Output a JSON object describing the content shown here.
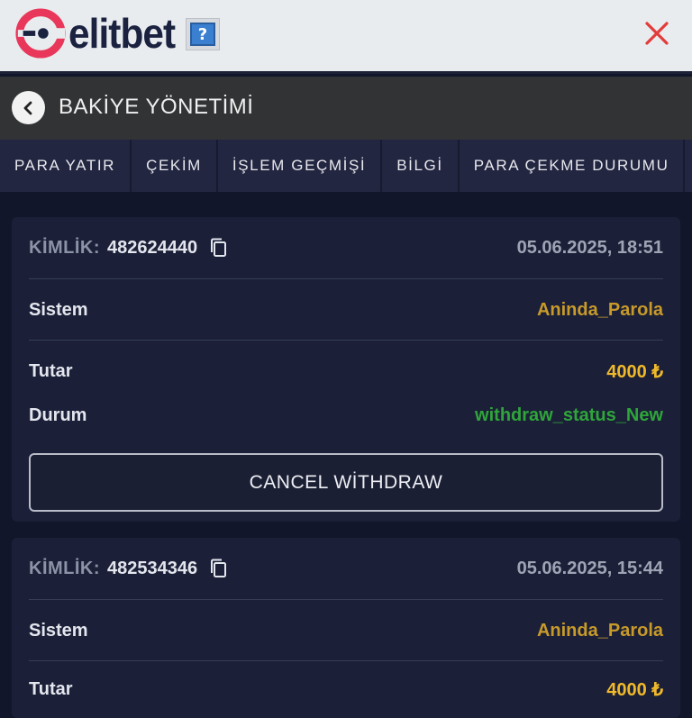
{
  "header": {
    "brand_name": "elitbet",
    "help_symbol": "?",
    "close_icon": "close-icon",
    "accent_color": "#e8375a"
  },
  "titlebar": {
    "title": "BAKİYE YÖNETİMİ",
    "back_icon": "chevron-left-icon"
  },
  "tabs": [
    {
      "label": "PARA YATIR"
    },
    {
      "label": "ÇEKİM"
    },
    {
      "label": "İŞLEM GEÇMİŞİ"
    },
    {
      "label": "BİLGİ"
    },
    {
      "label": "PARA ÇEKME DURUMU"
    }
  ],
  "withdrawals": [
    {
      "id_label": "KİMLİK:",
      "id_value": "482624440",
      "datetime": "05.06.2025, 18:51",
      "system_label": "Sistem",
      "system_value": "Aninda_Parola",
      "amount_label": "Tutar",
      "amount_value": "4000 ₺",
      "status_label": "Durum",
      "status_value": "withdraw_status_New",
      "cancel_label": "CANCEL WİTHDRAW"
    },
    {
      "id_label": "KİMLİK:",
      "id_value": "482534346",
      "datetime": "05.06.2025, 15:44",
      "system_label": "Sistem",
      "system_value": "Aninda_Parola",
      "amount_label": "Tutar",
      "amount_value": "4000 ₺"
    }
  ]
}
